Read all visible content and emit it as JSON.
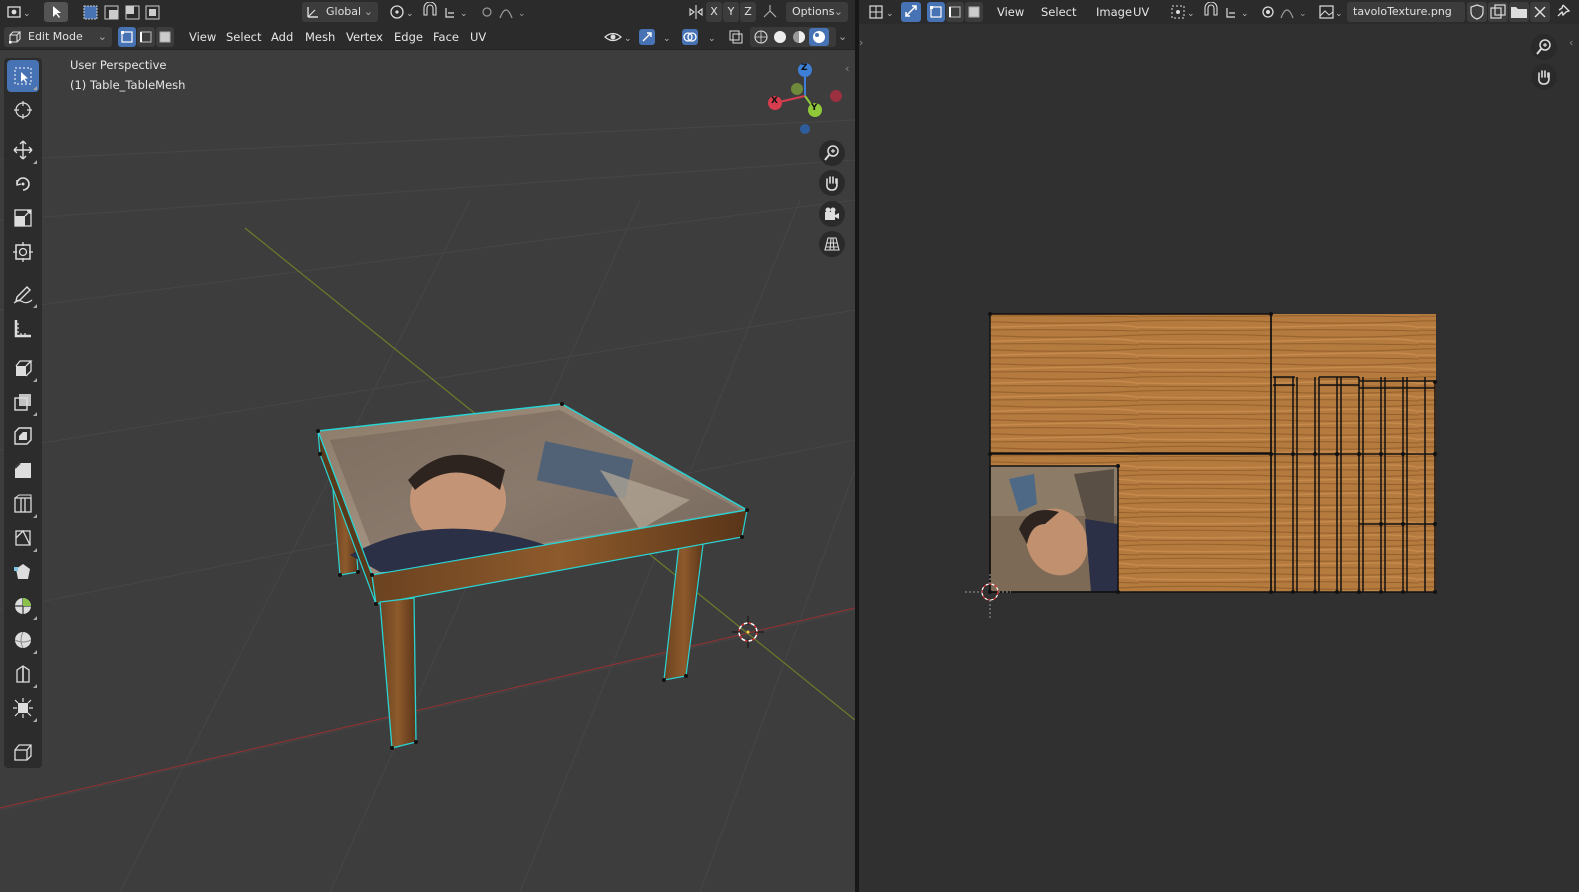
{
  "viewport3d": {
    "header_top": {
      "orientation": "Global",
      "options": "Options",
      "axes": [
        "X",
        "Y",
        "Z"
      ]
    },
    "header_bottom": {
      "mode": "Edit Mode",
      "menus": [
        "View",
        "Select",
        "Add",
        "Mesh",
        "Vertex",
        "Edge",
        "Face",
        "UV"
      ]
    },
    "info": {
      "view_name": "User Perspective",
      "object_name": "(1) Table_TableMesh"
    },
    "gizmo": {
      "x": "X",
      "y": "Y",
      "z": "Z"
    },
    "tools": [
      "select-box-tool",
      "cursor-tool",
      "move-tool",
      "rotate-tool",
      "scale-tool",
      "transform-tool",
      "annotate-tool",
      "measure-tool",
      "add-cube-tool",
      "extrude-region-tool",
      "inset-faces-tool",
      "bevel-tool",
      "loop-cut-tool",
      "knife-tool",
      "poly-build-tool",
      "spin-tool",
      "smooth-tool",
      "edge-slide-tool",
      "shrink-fatten-tool",
      "shear-tool",
      "rip-region-tool"
    ]
  },
  "uv_editor": {
    "menus": [
      "View",
      "Select",
      "Image",
      "UV"
    ],
    "image_name": "tavoloTexture.png"
  },
  "colors": {
    "accent": "#4772b3",
    "selected_edge": "#29d3d3",
    "wood": "#b47a3e",
    "grid_x": "#8a3434",
    "grid_y": "#6b7c2a"
  }
}
